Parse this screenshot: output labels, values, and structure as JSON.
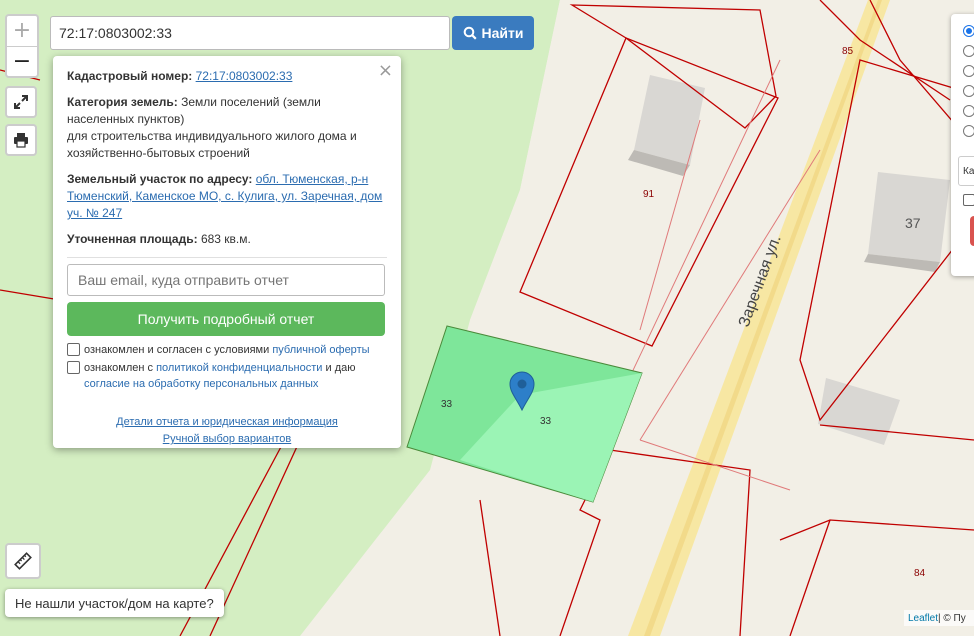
{
  "search": {
    "value": "72:17:0803002:33",
    "button_label": "Найти"
  },
  "zoom": {
    "in": "+",
    "out": "−"
  },
  "popup": {
    "close": "×",
    "cadastral_label": "Кадастровый номер:",
    "cadastral_value": "72:17:0803002:33",
    "category_label": "Категория земель:",
    "category_value": "Земли поселений (земли населенных пунктов)",
    "category_usage": "для строительства индивидуального жилого дома и хозяйственно-бытовых строений",
    "address_label": "Земельный участок по адресу:",
    "address_value": "обл. Тюменская, р-н Тюменский, Каменское МО, с. Кулига, ул. Заречная, дом уч. № 247",
    "area_label": "Уточненная площадь:",
    "area_value": "683 кв.м.",
    "email_placeholder": "Ваш email, куда отправить отчет",
    "report_button": "Получить подробный отчет",
    "agree1_text": "ознакомлен и согласен с условиями",
    "agree1_link": "публичной оферты",
    "agree2_text": "ознакомлен с",
    "agree2_link": "политикой конфиденциальности",
    "agree2_text2": "и даю",
    "agree2_link2": "согласие на обработку персональных данных",
    "details_link": "Детали отчета и юридическая информация",
    "manual_link": "Ручной выбор вариантов"
  },
  "map": {
    "street": "Заречная ул.",
    "labels": {
      "n85": "85",
      "n91": "91",
      "n37": "37",
      "n33a": "33",
      "n33b": "33",
      "n84": "84"
    }
  },
  "right_panel": {
    "input_stub": "Ка"
  },
  "not_found_button": "Не нашли участок/дом на карте?",
  "attribution": {
    "leaflet": "Leaflet",
    "sep": " | © Пу"
  },
  "colors": {
    "accent": "#3a7bbf",
    "green_button": "#5cb85c",
    "parcel_boundary": "#c00000",
    "selected_parcel": "#7ee69a"
  }
}
